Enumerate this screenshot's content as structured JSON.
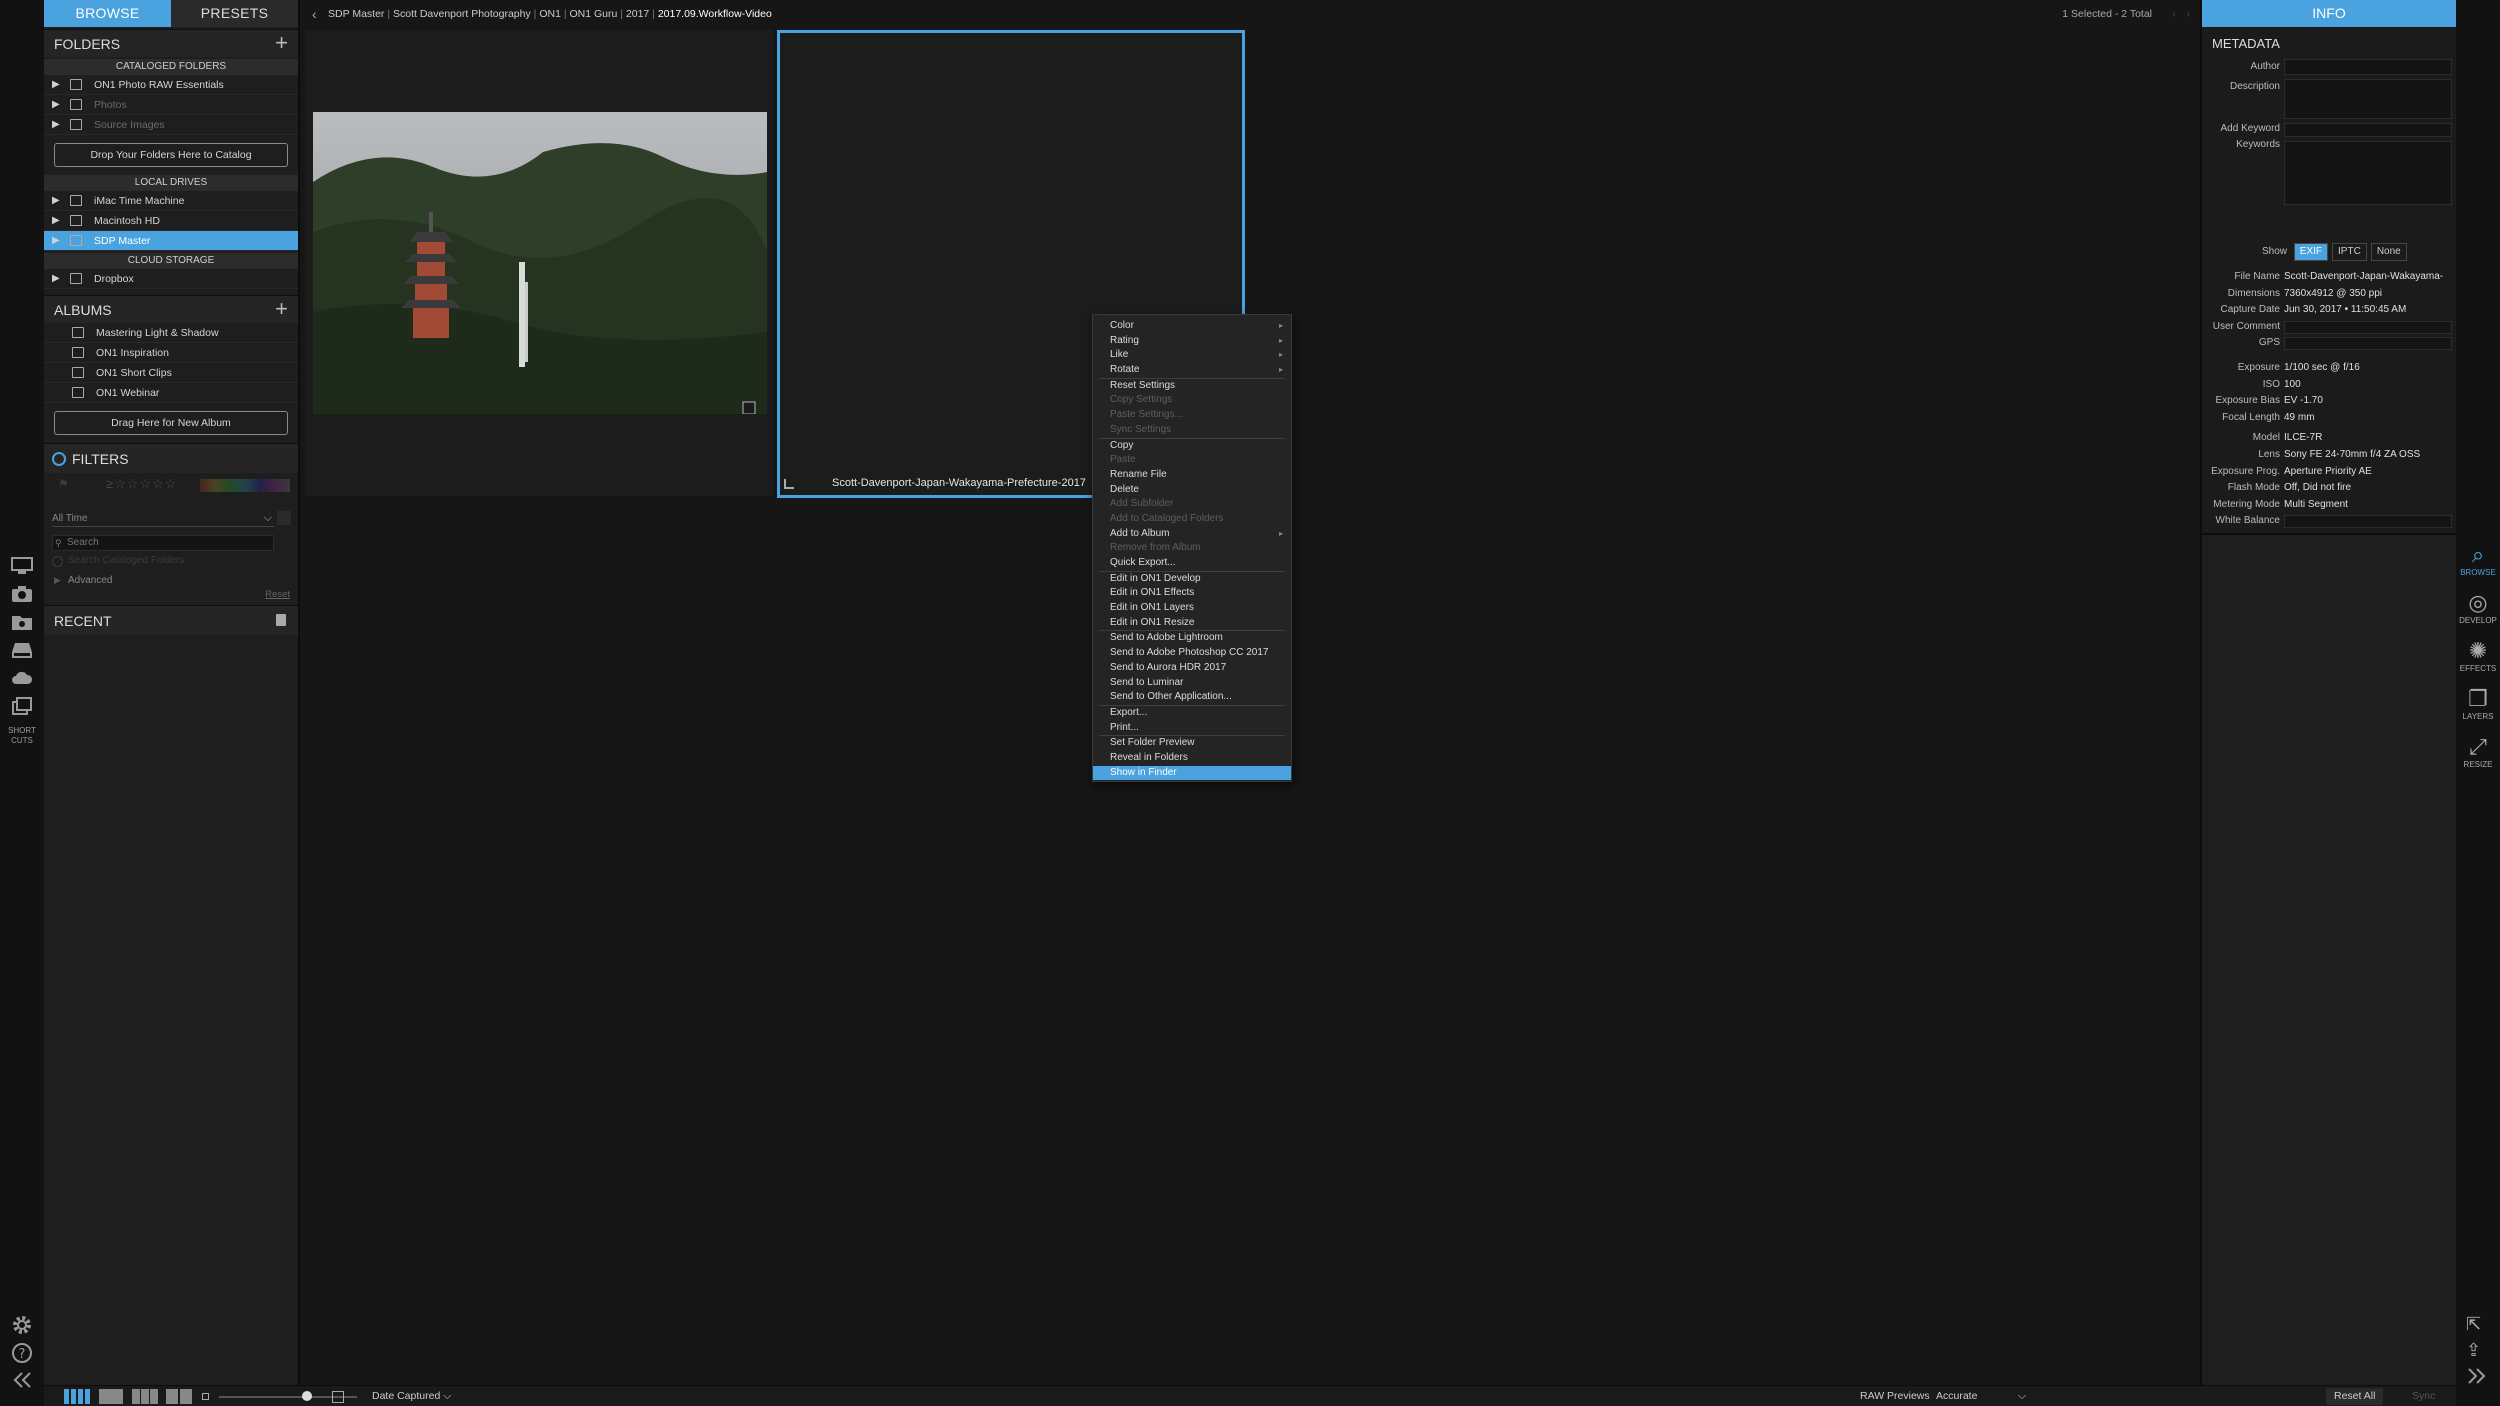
{
  "left_tabs": {
    "browse": "BROWSE",
    "presets": "PRESETS"
  },
  "folders": {
    "header": "FOLDERS",
    "add": "+",
    "cataloged_header": "CATALOGED FOLDERS",
    "cataloged": [
      {
        "label": "ON1 Photo RAW Essentials",
        "dim": false
      },
      {
        "label": "Photos",
        "dim": true
      },
      {
        "label": "Source Images",
        "dim": true
      }
    ],
    "drop_button": "Drop Your Folders Here to Catalog",
    "local_header": "LOCAL DRIVES",
    "local": [
      {
        "label": "iMac Time Machine"
      },
      {
        "label": "Macintosh HD"
      },
      {
        "label": "SDP Master"
      }
    ],
    "cloud_header": "CLOUD STORAGE",
    "cloud": [
      {
        "label": "Dropbox"
      }
    ]
  },
  "albums": {
    "header": "ALBUMS",
    "add": "+",
    "items": [
      "Mastering Light & Shadow",
      "ON1 Inspiration",
      "ON1 Short Clips",
      "ON1 Webinar"
    ],
    "new_button": "Drag Here for New Album"
  },
  "filters": {
    "header": "FILTERS",
    "stars": "≥☆☆☆☆☆",
    "time": "All Time",
    "search_placeholder": "Search",
    "search_cataloged": "Search Cataloged Folders",
    "advanced": "Advanced",
    "reset": "Reset"
  },
  "recent": {
    "header": "RECENT"
  },
  "left_strip": {
    "shortcuts": "SHORT CUTS"
  },
  "breadcrumb": [
    "SDP Master",
    "Scott Davenport Photography",
    "ON1",
    "ON1 Guru",
    "2017",
    "2017.09.Workflow-Video"
  ],
  "selection_status": "1 Selected - 2 Total",
  "thumbnail": {
    "caption": "Scott-Davenport-Japan-Wakayama-Prefecture-2017"
  },
  "context_menu": [
    {
      "label": "Color",
      "sub": true
    },
    {
      "label": "Rating",
      "sub": true
    },
    {
      "label": "Like",
      "sub": true
    },
    {
      "label": "Rotate",
      "sub": true
    },
    {
      "sep": true
    },
    {
      "label": "Reset Settings"
    },
    {
      "label": "Copy Settings",
      "dis": true
    },
    {
      "label": "Paste Settings...",
      "dis": true
    },
    {
      "label": "Sync Settings",
      "dis": true
    },
    {
      "sep": true
    },
    {
      "label": "Copy"
    },
    {
      "label": "Paste",
      "dis": true
    },
    {
      "label": "Rename File"
    },
    {
      "label": "Delete"
    },
    {
      "label": "Add Subfolder",
      "dis": true
    },
    {
      "label": "Add to Cataloged Folders",
      "dis": true
    },
    {
      "label": "Add to Album",
      "sub": true
    },
    {
      "label": "Remove from Album",
      "dis": true
    },
    {
      "label": "Quick Export..."
    },
    {
      "sep": true
    },
    {
      "label": "Edit in ON1 Develop"
    },
    {
      "label": "Edit in ON1 Effects"
    },
    {
      "label": "Edit in ON1 Layers"
    },
    {
      "label": "Edit in ON1 Resize"
    },
    {
      "sep": true
    },
    {
      "label": "Send to Adobe Lightroom"
    },
    {
      "label": "Send to Adobe Photoshop CC 2017"
    },
    {
      "label": "Send to Aurora HDR 2017"
    },
    {
      "label": "Send to Luminar"
    },
    {
      "label": "Send to Other Application..."
    },
    {
      "sep": true
    },
    {
      "label": "Export..."
    },
    {
      "label": "Print..."
    },
    {
      "sep": true
    },
    {
      "label": "Set Folder Preview"
    },
    {
      "label": "Reveal in Folders"
    },
    {
      "label": "Show in Finder",
      "hl": true
    }
  ],
  "info": {
    "tab": "INFO",
    "metadata_header": "METADATA",
    "author": "Author",
    "description": "Description",
    "add_keyword": "Add Keyword",
    "keywords": "Keywords",
    "show": "Show",
    "show_options": [
      "EXIF",
      "IPTC",
      "None"
    ],
    "file_rows": [
      {
        "k": "File Name",
        "v": "Scott-Davenport-Japan-Wakayama-"
      },
      {
        "k": "Dimensions",
        "v": "7360x4912 @ 350 ppi"
      },
      {
        "k": "Capture Date",
        "v": "Jun 30, 2017 • 11:50:45 AM"
      },
      {
        "k": "User Comment",
        "v": ""
      },
      {
        "k": "GPS",
        "v": ""
      }
    ],
    "exposure_rows": [
      {
        "k": "Exposure",
        "v": "1/100 sec @ f/16"
      },
      {
        "k": "ISO",
        "v": "100"
      },
      {
        "k": "Exposure Bias",
        "v": "EV -1.70"
      },
      {
        "k": "Focal Length",
        "v": "49 mm"
      }
    ],
    "camera_rows": [
      {
        "k": "Model",
        "v": "ILCE-7R"
      },
      {
        "k": "Lens",
        "v": "Sony FE 24-70mm f/4 ZA OSS"
      },
      {
        "k": "Exposure Prog.",
        "v": "Aperture Priority AE"
      },
      {
        "k": "Flash Mode",
        "v": "Off, Did not fire"
      },
      {
        "k": "Metering Mode",
        "v": "Multi Segment"
      },
      {
        "k": "White Balance",
        "v": ""
      }
    ]
  },
  "right_strip": [
    {
      "id": "browse",
      "label": "BROWSE",
      "active": true
    },
    {
      "id": "develop",
      "label": "DEVELOP"
    },
    {
      "id": "effects",
      "label": "EFFECTS"
    },
    {
      "id": "layers",
      "label": "LAYERS"
    },
    {
      "id": "resize",
      "label": "RESIZE"
    }
  ],
  "bottom": {
    "sort": "Date Captured",
    "raw_previews": "RAW Previews",
    "raw_mode": "Accurate",
    "reset_all": "Reset All",
    "sync": "Sync"
  },
  "colors": {
    "accent": "#4aa3df",
    "panel": "#1e1e1e",
    "background": "#161616"
  }
}
